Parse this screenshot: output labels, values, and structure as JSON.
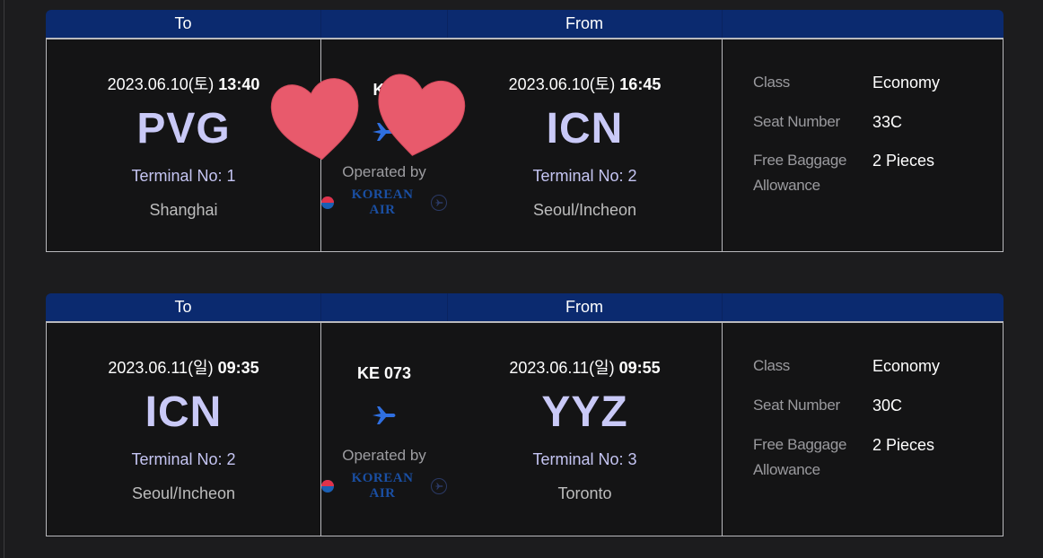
{
  "headers": {
    "to": "To",
    "from": "From"
  },
  "flights": [
    {
      "origin": {
        "date": "2023.06.10(토) ",
        "time": "13:40",
        "code": "PVG",
        "terminal": "Terminal No: 1",
        "city": "Shanghai"
      },
      "flight_no": "KE",
      "operated_by": "Operated by",
      "airline_logo_text": "KOREAN AIR",
      "destination": {
        "date": "2023.06.10(토) ",
        "time": "16:45",
        "code": "ICN",
        "terminal": "Terminal No: 2",
        "city": "Seoul/Incheon"
      },
      "info": {
        "class_label": "Class",
        "class_value": "Economy",
        "seat_label": "Seat Number",
        "seat_value": "33C",
        "baggage_label_1": "Free Baggage",
        "baggage_label_2": "Allowance",
        "baggage_value": "2 Pieces"
      }
    },
    {
      "origin": {
        "date": "2023.06.11(일) ",
        "time": "09:35",
        "code": "ICN",
        "terminal": "Terminal No: 2",
        "city": "Seoul/Incheon"
      },
      "flight_no": "KE 073",
      "operated_by": "Operated by",
      "airline_logo_text": "KOREAN AIR",
      "destination": {
        "date": "2023.06.11(일) ",
        "time": "09:55",
        "code": "YYZ",
        "terminal": "Terminal No: 3",
        "city": "Toronto"
      },
      "info": {
        "class_label": "Class",
        "class_value": "Economy",
        "seat_label": "Seat Number",
        "seat_value": "30C",
        "baggage_label_1": "Free Baggage",
        "baggage_label_2": "Allowance",
        "baggage_value": "2 Pieces"
      }
    }
  ],
  "colors": {
    "header_bg": "#0b2a6f",
    "code": "#c9c9f7",
    "plane": "#2f6fe0",
    "heart": "#e85a6c"
  },
  "icons": {
    "plane": "airplane-icon",
    "sticker": "heart-sticker-icon"
  }
}
